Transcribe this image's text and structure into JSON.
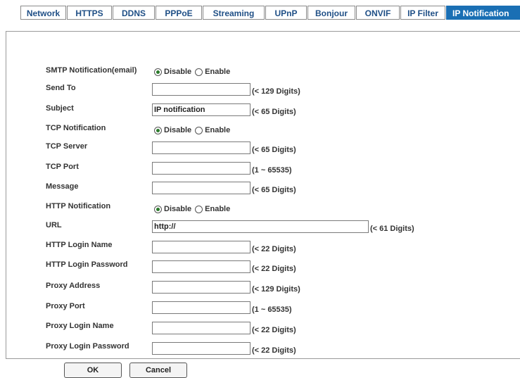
{
  "tabs": [
    {
      "label": "Network",
      "active": false
    },
    {
      "label": "HTTPS",
      "active": false
    },
    {
      "label": "DDNS",
      "active": false
    },
    {
      "label": "PPPoE",
      "active": false
    },
    {
      "label": "Streaming",
      "active": false
    },
    {
      "label": "UPnP",
      "active": false
    },
    {
      "label": "Bonjour",
      "active": false
    },
    {
      "label": "ONVIF",
      "active": false
    },
    {
      "label": "IP Filter",
      "active": false
    },
    {
      "label": "IP Notification",
      "active": true
    }
  ],
  "form": {
    "smtp_notification": {
      "label": "SMTP Notification(email)",
      "disable": "Disable",
      "enable": "Enable",
      "selected": "Disable"
    },
    "send_to": {
      "label": "Send To",
      "value": "",
      "hint": "(< 129 Digits)"
    },
    "subject": {
      "label": "Subject",
      "value": "IP notification",
      "hint": "(< 65 Digits)"
    },
    "tcp_notification": {
      "label": "TCP Notification",
      "disable": "Disable",
      "enable": "Enable",
      "selected": "Disable"
    },
    "tcp_server": {
      "label": "TCP Server",
      "value": "",
      "hint": "(< 65 Digits)"
    },
    "tcp_port": {
      "label": "TCP Port",
      "value": "",
      "hint": "(1 ~ 65535)"
    },
    "message": {
      "label": "Message",
      "value": "",
      "hint": "(< 65 Digits)"
    },
    "http_notification": {
      "label": "HTTP Notification",
      "disable": "Disable",
      "enable": "Enable",
      "selected": "Disable"
    },
    "url": {
      "label": "URL",
      "value": "http://",
      "hint": "(< 61 Digits)"
    },
    "http_login_name": {
      "label": "HTTP Login Name",
      "value": "",
      "hint": "(< 22 Digits)"
    },
    "http_login_password": {
      "label": "HTTP Login Password",
      "value": "",
      "hint": "(< 22 Digits)"
    },
    "proxy_address": {
      "label": "Proxy Address",
      "value": "",
      "hint": "(< 129 Digits)"
    },
    "proxy_port": {
      "label": "Proxy Port",
      "value": "",
      "hint": "(1 ~ 65535)"
    },
    "proxy_login_name": {
      "label": "Proxy Login Name",
      "value": "",
      "hint": "(< 22 Digits)"
    },
    "proxy_login_password": {
      "label": "Proxy Login Password",
      "value": "",
      "hint": "(< 22 Digits)"
    }
  },
  "buttons": {
    "ok": "OK",
    "cancel": "Cancel"
  },
  "colors": {
    "tab_text": "#1f4f86",
    "tab_active_bg": "#1a6fb4",
    "radio_dot": "#2a7a2a"
  }
}
